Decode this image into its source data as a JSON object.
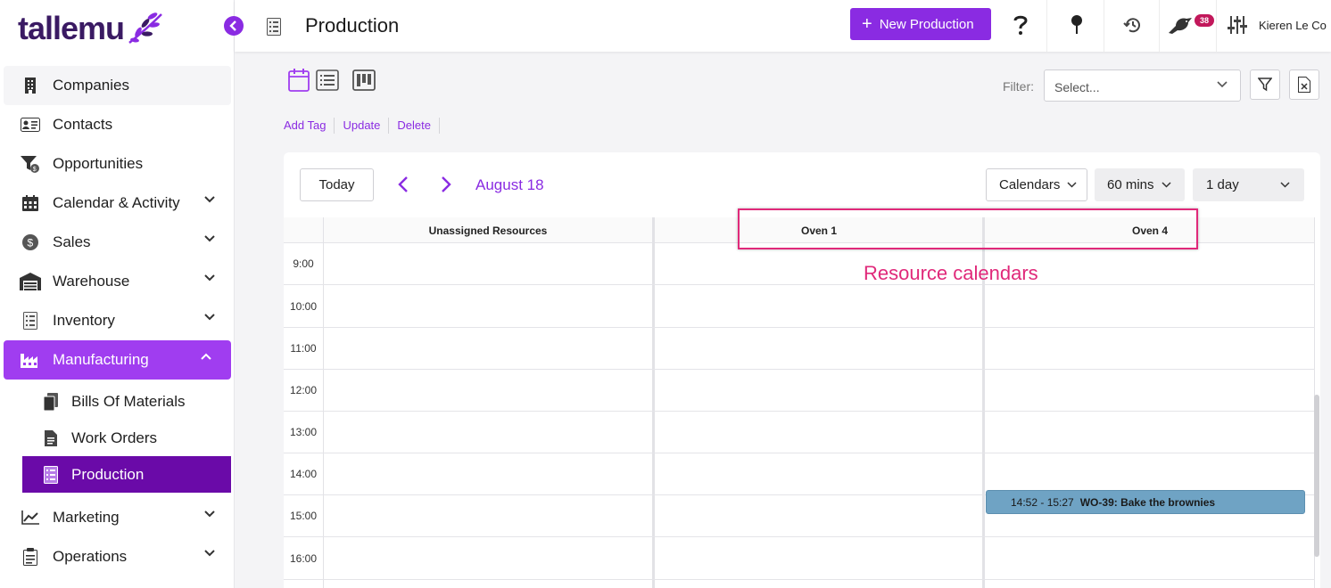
{
  "app": {
    "logo_text": "tallemu"
  },
  "sidebar": {
    "items": [
      {
        "label": "Companies",
        "icon": "building-icon"
      },
      {
        "label": "Contacts",
        "icon": "contact-card-icon"
      },
      {
        "label": "Opportunities",
        "icon": "funnel-icon"
      },
      {
        "label": "Calendar & Activity",
        "icon": "calendar-icon"
      },
      {
        "label": "Sales",
        "icon": "dollar-icon"
      },
      {
        "label": "Warehouse",
        "icon": "warehouse-icon"
      },
      {
        "label": "Inventory",
        "icon": "list-icon"
      },
      {
        "label": "Manufacturing",
        "icon": "factory-icon"
      },
      {
        "label": "Marketing",
        "icon": "chart-line-icon"
      },
      {
        "label": "Operations",
        "icon": "clipboard-icon"
      }
    ],
    "sub_items": [
      {
        "label": "Bills Of Materials",
        "icon": "documents-icon"
      },
      {
        "label": "Work Orders",
        "icon": "document-icon"
      },
      {
        "label": "Production",
        "icon": "production-list-icon"
      }
    ]
  },
  "header": {
    "title": "Production",
    "new_button": "New Production",
    "user_name": "Kieren Le Co",
    "notification_count": "38"
  },
  "toolbar": {
    "filter_label": "Filter:",
    "filter_placeholder": "Select...",
    "actions": [
      "Add Tag",
      "Update",
      "Delete"
    ]
  },
  "calendar": {
    "today_label": "Today",
    "date_label": "August 18",
    "calendars_label": "Calendars",
    "interval_label": "60 mins",
    "range_label": "1 day",
    "columns": [
      "Unassigned Resources",
      "Oven 1",
      "Oven 4"
    ],
    "times": [
      "9:00",
      "10:00",
      "11:00",
      "12:00",
      "13:00",
      "14:00",
      "15:00",
      "16:00"
    ],
    "event": {
      "time": "14:52 - 15:27",
      "title": "WO-39: Bake the brownies",
      "color": "#6fa3c4"
    }
  },
  "annotation": {
    "text": "Resource calendars"
  },
  "colors": {
    "accent": "#8a2be2",
    "active_sub": "#6a0aa8",
    "annotation": "#e0297a",
    "badge": "#c2185b"
  }
}
